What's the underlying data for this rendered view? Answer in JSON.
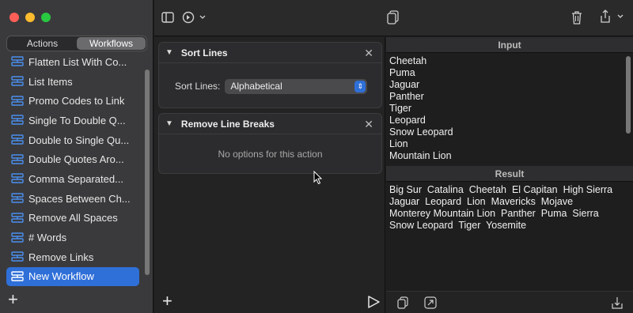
{
  "sidebar": {
    "tabs": [
      "Actions",
      "Workflows"
    ],
    "active_tab": "Workflows",
    "items": [
      {
        "label": "Flatten List With Co..."
      },
      {
        "label": "List Items"
      },
      {
        "label": "Promo Codes to Link"
      },
      {
        "label": "Single To Double Q..."
      },
      {
        "label": "Double to Single Qu..."
      },
      {
        "label": "Double Quotes Aro..."
      },
      {
        "label": "Comma Separated..."
      },
      {
        "label": "Spaces Between Ch..."
      },
      {
        "label": "Remove All Spaces"
      },
      {
        "label": "# Words"
      },
      {
        "label": "Remove Links"
      },
      {
        "label": "New Workflow"
      }
    ],
    "selected_item": "New Workflow",
    "add_label": "+"
  },
  "actions": [
    {
      "title": "Sort Lines",
      "option_label": "Sort Lines:",
      "option_value": "Alphabetical"
    },
    {
      "title": "Remove Line Breaks",
      "empty_text": "No options for this action"
    }
  ],
  "middle": {
    "add_label": "+"
  },
  "input": {
    "header": "Input",
    "lines": [
      "Cheetah",
      "Puma",
      "Jaguar",
      "Panther",
      "Tiger",
      "Leopard",
      "Snow Leopard",
      "Lion",
      "Mountain Lion"
    ]
  },
  "result": {
    "header": "Result",
    "text": "Big Sur  Catalina  Cheetah  El Capitan  High Sierra\nJaguar  Leopard  Lion  Mavericks  Mojave\nMonterey Mountain Lion  Panther  Puma  Sierra\nSnow Leopard  Tiger  Yosemite"
  },
  "colors": {
    "accent": "#2f6fd8",
    "sidebar_bg": "#3a3a3c",
    "window_bg": "#1e1e1e"
  }
}
